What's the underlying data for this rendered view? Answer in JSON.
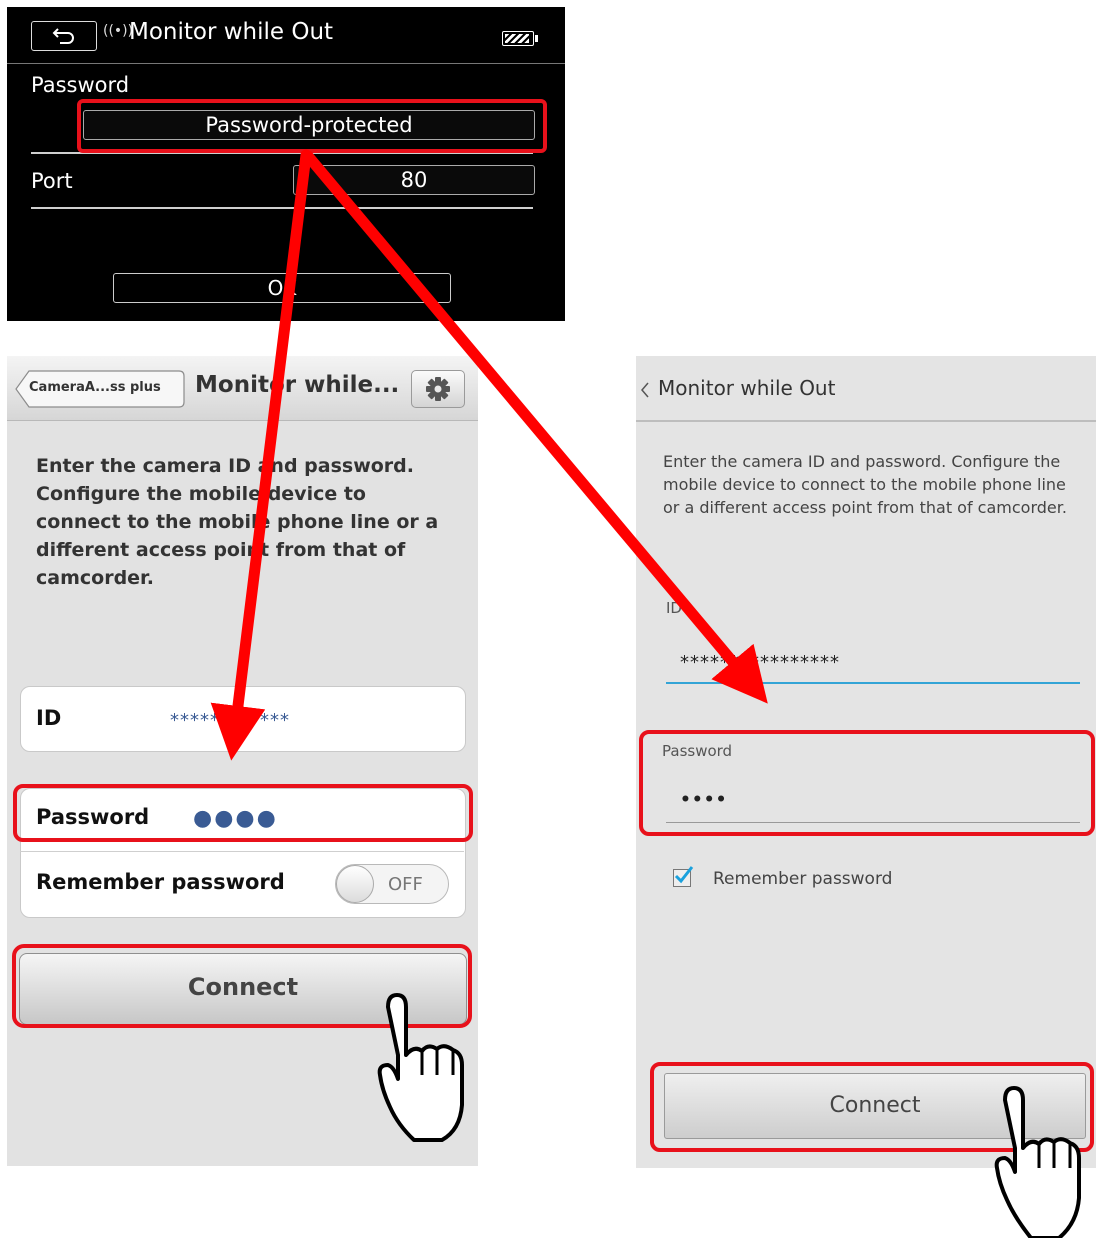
{
  "camera": {
    "title": "Monitor while Out",
    "wifi_icon": "((•))",
    "password_label": "Password",
    "password_value": "Password-protected",
    "port_label": "Port",
    "port_value": "80",
    "ok_label": "OK",
    "icons": [
      "back-arrow-icon",
      "wifi-icon",
      "battery-icon"
    ]
  },
  "ios": {
    "back_label": "CameraA...ss plus",
    "title": "Monitor while...",
    "description": "Enter the camera ID and password. Configure the mobile device to connect to the mobile phone line or a different access point from that of camcorder.",
    "id_label": "ID",
    "id_value": "************",
    "password_label": "Password",
    "password_value": "●●●●",
    "remember_label": "Remember password",
    "toggle_state": "OFF",
    "connect_label": "Connect",
    "icons": [
      "gear-icon"
    ]
  },
  "android": {
    "title": "Monitor while Out",
    "description": "Enter the camera ID and password. Configure the mobile device to connect to the mobile phone line or a different access point from that of camcorder.",
    "id_label": "ID",
    "id_value": "****************",
    "password_label": "Password",
    "password_value": "••••",
    "remember_label": "Remember password",
    "remember_checked": true,
    "connect_label": "Connect"
  },
  "colors": {
    "highlight": "#e8111b",
    "arrow": "#ff0000",
    "ios_value": "#3a5b94",
    "android_accent": "#33a4d6"
  }
}
